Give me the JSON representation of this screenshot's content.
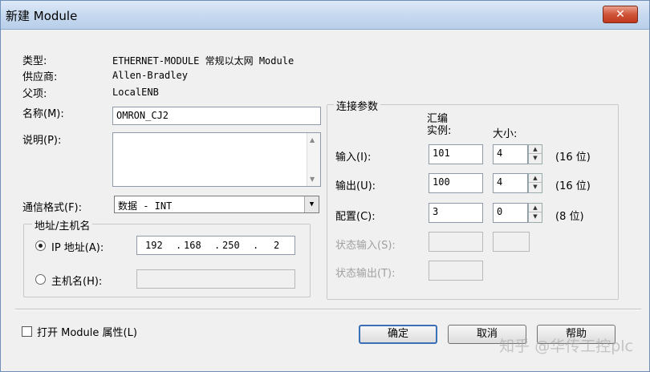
{
  "window": {
    "title": "新建 Module",
    "close_glyph": "✕"
  },
  "info": {
    "type_label": "类型:",
    "type_value": "ETHERNET-MODULE 常规以太网 Module",
    "vendor_label": "供应商:",
    "vendor_value": "Allen-Bradley",
    "parent_label": "父项:",
    "parent_value": "LocalENB"
  },
  "name": {
    "label": "名称(M):",
    "value": "OMRON_CJ2"
  },
  "description": {
    "label": "说明(P):",
    "value": ""
  },
  "comm_format": {
    "label": "通信格式(F):",
    "value": "数据 - INT"
  },
  "address_group": {
    "title": "地址/主机名",
    "ip_label": "IP 地址(A):",
    "ip_octets": [
      "192",
      "168",
      "250",
      "2"
    ],
    "host_label": "主机名(H):",
    "host_value": "",
    "selected": "ip"
  },
  "connection": {
    "title": "连接参数",
    "col_instance": "汇编实例:",
    "col_instance_line1": "汇编",
    "col_instance_line2": "实例:",
    "col_size": "大小:",
    "rows": [
      {
        "label": "输入(I):",
        "instance": "101",
        "size": "4",
        "unit": "(16 位)",
        "enabled": true
      },
      {
        "label": "输出(U):",
        "instance": "100",
        "size": "4",
        "unit": "(16 位)",
        "enabled": true
      },
      {
        "label": "配置(C):",
        "instance": "3",
        "size": "0",
        "unit": "(8 位)",
        "enabled": true
      },
      {
        "label": "状态输入(S):",
        "instance": "",
        "size": "",
        "unit": "",
        "enabled": false
      },
      {
        "label": "状态输出(T):",
        "instance": "",
        "size": "",
        "unit": "",
        "enabled": false
      }
    ]
  },
  "footer": {
    "open_props_label": "打开 Module 属性(L)",
    "open_props_checked": false,
    "ok_label": "确定",
    "cancel_label": "取消",
    "help_label": "帮助"
  },
  "watermark": "知乎 @华传工控plc"
}
